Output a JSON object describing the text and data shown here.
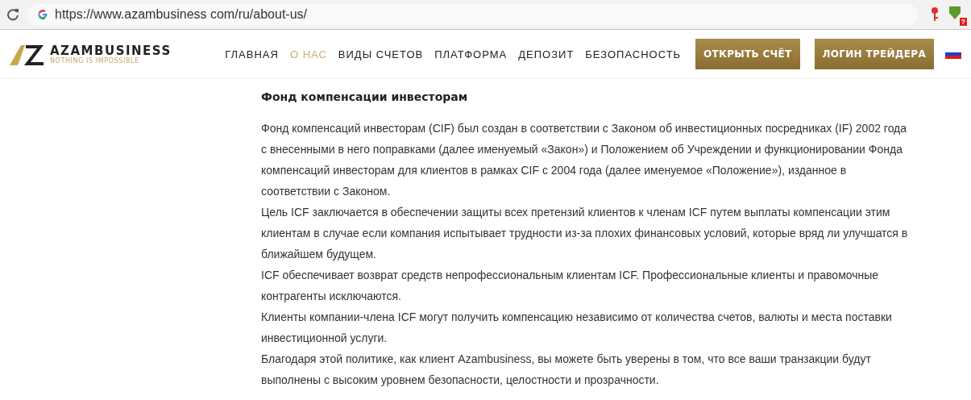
{
  "browser": {
    "url": "https://www.azambusiness com/ru/about-us/",
    "extension_badge": "?"
  },
  "logo": {
    "name": "AZAMBUSINESS",
    "tagline": "NOTHING IS IMPOSSIBLE"
  },
  "nav": [
    {
      "label": "ГЛАВНАЯ",
      "selected": false
    },
    {
      "label": "О НАС",
      "selected": true
    },
    {
      "label": "ВИДЫ СЧЕТОВ",
      "selected": false
    },
    {
      "label": "ПЛАТФОРМА",
      "selected": false
    },
    {
      "label": "ДЕПОЗИТ",
      "selected": false
    },
    {
      "label": "БЕЗОПАСНОСТЬ",
      "selected": false
    }
  ],
  "buttons": [
    "ОТКРЫТЬ СЧЁТ",
    "ЛОГИН ТРЕЙДЕРА"
  ],
  "article": {
    "title": "Фонд компенсации инвесторам",
    "paragraphs": [
      "Фонд компенсаций инвесторам (CIF) был создан в соответствии с Законом об инвестиционных посредниках (IF) 2002 года с внесенными в него поправками (далее именуемый «Закон») и Положением об Учреждении и функционировании Фонда компенсаций инвесторам для клиентов в рамках CIF с 2004 года (далее именуемое «Положение»), изданное в соответствии с Законом.",
      "Цель ICF заключается в обеспечении защиты всех претензий клиентов к членам ICF путем выплаты компенсации этим клиентам в случае если компания испытывает трудности из-за плохих финансовых условий, которые вряд ли улучшатся в ближайшем будущем.",
      "ICF обеспечивает возврат средств непрофессиональным клиентам ICF. Профессиональные клиенты и правомочные контрагенты исключаются.",
      "Клиенты компании-члена ICF могут получить компенсацию независимо от количества счетов, валюты и места поставки инвестиционной услуги.",
      "Благодаря этой политике, как клиент Azambusiness, вы можете быть уверены в том, что все ваши транзакции будут выполнены с высоким уровнем безопасности, целостности и прозрачности."
    ]
  }
}
